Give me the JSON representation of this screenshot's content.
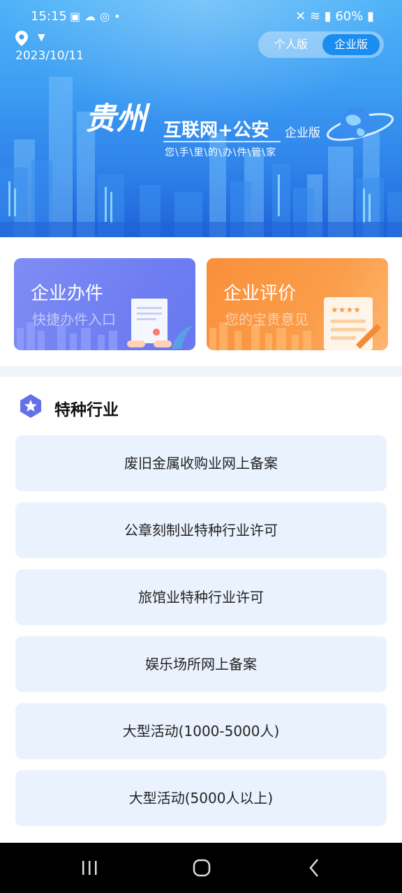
{
  "status_bar": {
    "time": "15:15",
    "notification_icons": [
      "image-icon",
      "cloud-icon",
      "target-icon",
      "dot"
    ],
    "battery": "60%"
  },
  "header": {
    "date": "2023/10/11",
    "toggle": {
      "personal": "个人版",
      "enterprise": "企业版",
      "selected": "enterprise"
    }
  },
  "banner": {
    "city_logo": "贵州",
    "brand": "互联网+公安",
    "edition": "企业版",
    "slogan": "您\\手\\里\\的\\办\\件\\管\\家"
  },
  "cards": [
    {
      "title": "企业办件",
      "subtitle": "快捷办件入口",
      "color": "#7482f2"
    },
    {
      "title": "企业评价",
      "subtitle": "您的宝贵意见",
      "color": "#fa9a45"
    }
  ],
  "section": {
    "title": "特种行业",
    "items": [
      "废旧金属收购业网上备案",
      "公章刻制业特种行业许可",
      "旅馆业特种行业许可",
      "娱乐场所网上备案",
      "大型活动(1000-5000人)",
      "大型活动(5000人以上)"
    ]
  },
  "colors": {
    "accent": "#1a8df0",
    "item_bg": "#eaf2fe",
    "section_icon": "#6570e8"
  }
}
